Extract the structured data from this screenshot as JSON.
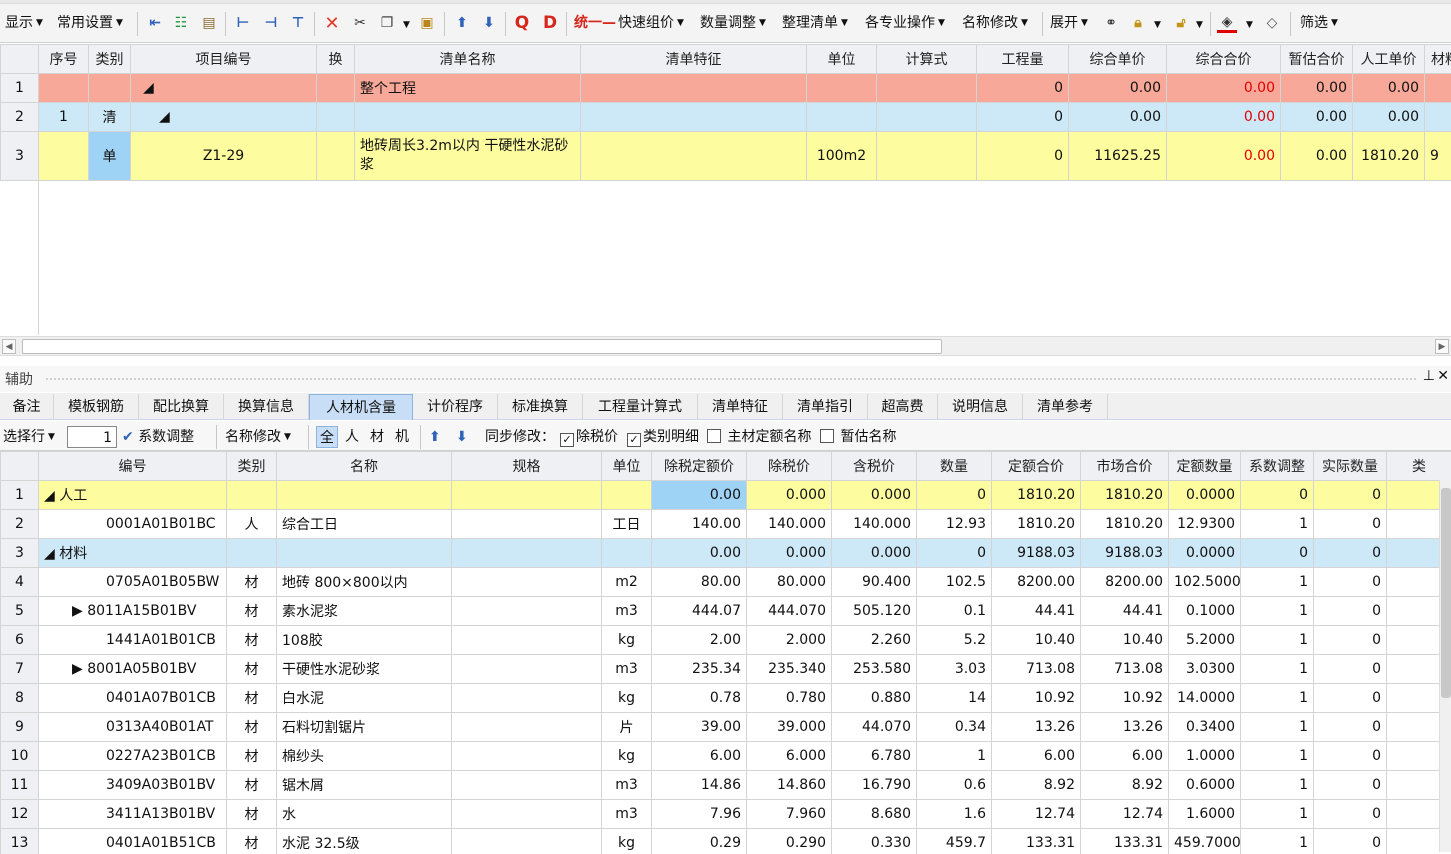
{
  "toolbar": {
    "display": "显示",
    "common_settings": "常用设置",
    "unify": "统一",
    "quick_price": "快速组价",
    "qty_adjust": "数量调整",
    "organize_list": "整理清单",
    "specialty_ops": "各专业操作",
    "rename": "名称修改",
    "expand": "展开",
    "filter": "筛选",
    "q_glyph": "Q",
    "d_glyph": "D"
  },
  "top_table": {
    "headers": [
      "序号",
      "类别",
      "项目编号",
      "换",
      "清单名称",
      "清单特征",
      "单位",
      "计算式",
      "工程量",
      "综合单价",
      "综合合价",
      "暂估合价",
      "人工单价",
      "材料"
    ],
    "rows": [
      {
        "rn": "1",
        "seq": "",
        "cat": "",
        "code": "◢",
        "swap": "",
        "name": "整个工程",
        "feat": "",
        "unit": "",
        "formula": "",
        "qty": "0",
        "unit_price": "0.00",
        "total": "0.00",
        "est": "0.00",
        "labor": "0.00",
        "mat": ""
      },
      {
        "rn": "2",
        "seq": "1",
        "cat": "清",
        "code": "◢",
        "swap": "",
        "name": "",
        "feat": "",
        "unit": "",
        "formula": "",
        "qty": "0",
        "unit_price": "0.00",
        "total": "0.00",
        "est": "0.00",
        "labor": "0.00",
        "mat": ""
      },
      {
        "rn": "3",
        "seq": "",
        "cat": "单",
        "code": "Z1-29",
        "swap": "",
        "name": "地砖周长3.2m以内 干硬性水泥砂浆",
        "feat": "",
        "unit": "100m2",
        "formula": "",
        "qty": "0",
        "unit_price": "11625.25",
        "total": "0.00",
        "est": "0.00",
        "labor": "1810.20",
        "mat": "9"
      }
    ]
  },
  "aux": {
    "title": "辅助",
    "tabs": [
      "备注",
      "模板钢筋",
      "配比换算",
      "换算信息",
      "人材机含量",
      "计价程序",
      "标准换算",
      "工程量计算式",
      "清单特征",
      "清单指引",
      "超高费",
      "说明信息",
      "清单参考"
    ],
    "active_tab": "人材机含量"
  },
  "subbar": {
    "select_row": "选择行",
    "row_value": "1",
    "coef_adjust": "系数调整",
    "rename": "名称修改",
    "f_all": "全",
    "f_person": "人",
    "f_material": "材",
    "f_machine": "机",
    "sync_label": "同步修改：",
    "chk_tax": "除税价",
    "chk_detail": "类别明细",
    "chk_main_name": "主材定额名称",
    "chk_est_name": "暂估名称"
  },
  "bottom_table": {
    "headers": [
      "编号",
      "类别",
      "名称",
      "规格",
      "单位",
      "除税定额价",
      "除税价",
      "含税价",
      "数量",
      "定额合价",
      "市场合价",
      "定额数量",
      "系数调整",
      "实际数量",
      "类"
    ],
    "rows": [
      {
        "rn": "1",
        "type": "group",
        "code": "◢ 人工",
        "cat": "",
        "name": "",
        "spec": "",
        "unit": "",
        "p1": "0.00",
        "p2": "0.000",
        "p3": "0.000",
        "qty": "0",
        "t1": "1810.20",
        "t2": "1810.20",
        "dq": "0.0000",
        "coef": "0",
        "actual": "0"
      },
      {
        "rn": "2",
        "type": "item",
        "code": "0001A01B01BC",
        "cat": "人",
        "name": "综合工日",
        "spec": "",
        "unit": "工日",
        "p1": "140.00",
        "p2": "140.000",
        "p3": "140.000",
        "qty": "12.93",
        "t1": "1810.20",
        "t2": "1810.20",
        "dq": "12.9300",
        "coef": "1",
        "actual": "0"
      },
      {
        "rn": "3",
        "type": "group2",
        "code": "◢ 材料",
        "cat": "",
        "name": "",
        "spec": "",
        "unit": "",
        "p1": "0.00",
        "p2": "0.000",
        "p3": "0.000",
        "qty": "0",
        "t1": "9188.03",
        "t2": "9188.03",
        "dq": "0.0000",
        "coef": "0",
        "actual": "0"
      },
      {
        "rn": "4",
        "type": "item",
        "code": "0705A01B05BW",
        "cat": "材",
        "name": "地砖 800×800以内",
        "spec": "",
        "unit": "m2",
        "p1": "80.00",
        "p2": "80.000",
        "p3": "90.400",
        "qty": "102.5",
        "t1": "8200.00",
        "t2": "8200.00",
        "dq": "102.5000",
        "coef": "1",
        "actual": "0"
      },
      {
        "rn": "5",
        "type": "item",
        "code": "▶ 8011A15B01BV",
        "cat": "材",
        "name": "素水泥浆",
        "spec": "",
        "unit": "m3",
        "p1": "444.07",
        "p2": "444.070",
        "p3": "505.120",
        "qty": "0.1",
        "t1": "44.41",
        "t2": "44.41",
        "dq": "0.1000",
        "coef": "1",
        "actual": "0"
      },
      {
        "rn": "6",
        "type": "item",
        "code": "1441A01B01CB",
        "cat": "材",
        "name": "108胶",
        "spec": "",
        "unit": "kg",
        "p1": "2.00",
        "p2": "2.000",
        "p3": "2.260",
        "qty": "5.2",
        "t1": "10.40",
        "t2": "10.40",
        "dq": "5.2000",
        "coef": "1",
        "actual": "0"
      },
      {
        "rn": "7",
        "type": "item",
        "code": "▶ 8001A05B01BV",
        "cat": "材",
        "name": "干硬性水泥砂浆",
        "spec": "",
        "unit": "m3",
        "p1": "235.34",
        "p2": "235.340",
        "p3": "253.580",
        "qty": "3.03",
        "t1": "713.08",
        "t2": "713.08",
        "dq": "3.0300",
        "coef": "1",
        "actual": "0"
      },
      {
        "rn": "8",
        "type": "item",
        "code": "0401A07B01CB",
        "cat": "材",
        "name": "白水泥",
        "spec": "",
        "unit": "kg",
        "p1": "0.78",
        "p2": "0.780",
        "p3": "0.880",
        "qty": "14",
        "t1": "10.92",
        "t2": "10.92",
        "dq": "14.0000",
        "coef": "1",
        "actual": "0"
      },
      {
        "rn": "9",
        "type": "item",
        "code": "0313A40B01AT",
        "cat": "材",
        "name": "石料切割锯片",
        "spec": "",
        "unit": "片",
        "p1": "39.00",
        "p2": "39.000",
        "p3": "44.070",
        "qty": "0.34",
        "t1": "13.26",
        "t2": "13.26",
        "dq": "0.3400",
        "coef": "1",
        "actual": "0"
      },
      {
        "rn": "10",
        "type": "item",
        "code": "0227A23B01CB",
        "cat": "材",
        "name": "棉纱头",
        "spec": "",
        "unit": "kg",
        "p1": "6.00",
        "p2": "6.000",
        "p3": "6.780",
        "qty": "1",
        "t1": "6.00",
        "t2": "6.00",
        "dq": "1.0000",
        "coef": "1",
        "actual": "0"
      },
      {
        "rn": "11",
        "type": "item",
        "code": "3409A03B01BV",
        "cat": "材",
        "name": "锯木屑",
        "spec": "",
        "unit": "m3",
        "p1": "14.86",
        "p2": "14.860",
        "p3": "16.790",
        "qty": "0.6",
        "t1": "8.92",
        "t2": "8.92",
        "dq": "0.6000",
        "coef": "1",
        "actual": "0"
      },
      {
        "rn": "12",
        "type": "item",
        "code": "3411A13B01BV",
        "cat": "材",
        "name": "水",
        "spec": "",
        "unit": "m3",
        "p1": "7.96",
        "p2": "7.960",
        "p3": "8.680",
        "qty": "1.6",
        "t1": "12.74",
        "t2": "12.74",
        "dq": "1.6000",
        "coef": "1",
        "actual": "0"
      },
      {
        "rn": "13",
        "type": "item",
        "code": "0401A01B51CB",
        "cat": "材",
        "name": "水泥 32.5级",
        "spec": "",
        "unit": "kg",
        "p1": "0.29",
        "p2": "0.290",
        "p3": "0.330",
        "qty": "459.7",
        "t1": "133.31",
        "t2": "133.31",
        "dq": "459.7000",
        "coef": "1",
        "actual": "0"
      }
    ]
  },
  "colors": {
    "pink_row": "#f8a899",
    "blue_row": "#cde8f6",
    "yellow_row": "#fdfd9f",
    "active_tab": "#c8def6",
    "red_value": "#e40000"
  }
}
